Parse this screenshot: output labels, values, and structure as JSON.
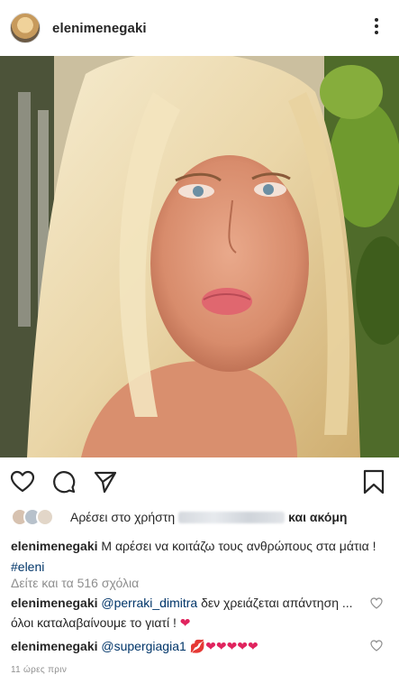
{
  "post": {
    "username": "elenimenegaki"
  },
  "likes": {
    "prefix": "Αρέσει στο χρήστη",
    "suffix": "και ακόμη"
  },
  "caption": {
    "username": "elenimenegaki",
    "text": "Μ αρέσει να κοιτάζω τους ανθρώπους στα μάτια !",
    "hashtag": "#eleni"
  },
  "view_all_comments": "Δείτε και τα 516 σχόλια",
  "comments": [
    {
      "username": "elenimenegaki",
      "mention": "@perraki_dimitra",
      "text": "δεν χρειάζεται απάντηση ... όλοι καταλαβαίνουμε το γιατί !",
      "emoji": "❤"
    },
    {
      "username": "elenimenegaki",
      "mention": "@supergiagia1",
      "text": "",
      "emoji": "💋❤❤❤❤❤"
    }
  ],
  "timestamp": "11 ώρες πριν",
  "colors": {
    "text": "#262626",
    "secondary": "#8e8e8e",
    "link": "#003569",
    "heart": "#e0245e"
  },
  "icons": [
    "more-vertical-icon",
    "heart-icon",
    "comment-icon",
    "share-icon",
    "bookmark-icon"
  ]
}
